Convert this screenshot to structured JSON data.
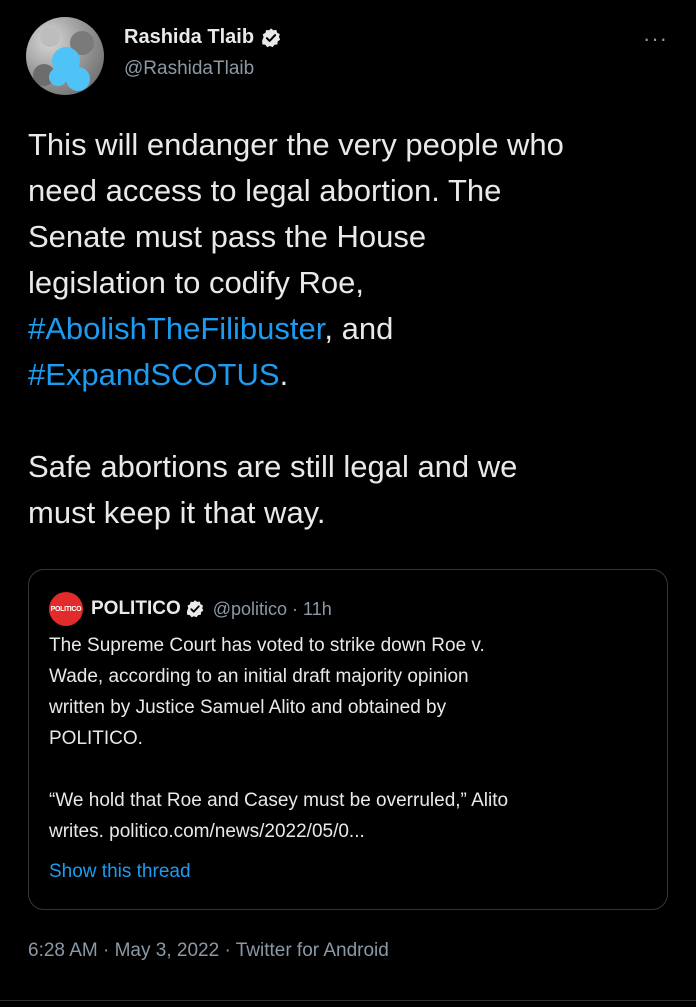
{
  "author": {
    "name": "Rashida Tlaib",
    "handle": "@RashidaTlaib",
    "verified_icon": "verified-badge-icon",
    "more_label": "···"
  },
  "tweet": {
    "lines": [
      {
        "text": "This will endanger the very people who",
        "hashtag": false
      },
      {
        "text": "need access to legal abortion. The",
        "hashtag": false
      },
      {
        "text": "Senate must pass the House",
        "hashtag": false
      },
      {
        "text": "legislation to codify Roe,",
        "hashtag": false
      }
    ],
    "hashtag1": "#AbolishTheFilibuster",
    "after_hashtag1": ", and",
    "hashtag2": "#ExpandSCOTUS",
    "after_hashtag2": ".",
    "para2_line1": "Safe abortions are still legal and we",
    "para2_line2": "must keep it that way."
  },
  "quote": {
    "logo_text": "POLITICO",
    "name": "POLITICO",
    "handle": "@politico",
    "separator": "·",
    "time": "11h",
    "line1": "The Supreme Court has voted to strike down Roe v.",
    "line2": "Wade, according to an initial draft majority opinion",
    "line3": "written by Justice Samuel Alito and obtained by",
    "line4": "POLITICO.",
    "line5": "“We hold that Roe and Casey must be overruled,” Alito",
    "line6": "writes. politico.com/news/2022/05/0...",
    "show_thread": "Show this thread"
  },
  "footer": {
    "text": "6:28 AM · May 3, 2022 · Twitter for Android"
  },
  "colors": {
    "background": "#000000",
    "text": "#e7e9ea",
    "secondary": "#8b98a5",
    "link": "#1d9bf0",
    "politico_red": "#e22b2b"
  }
}
